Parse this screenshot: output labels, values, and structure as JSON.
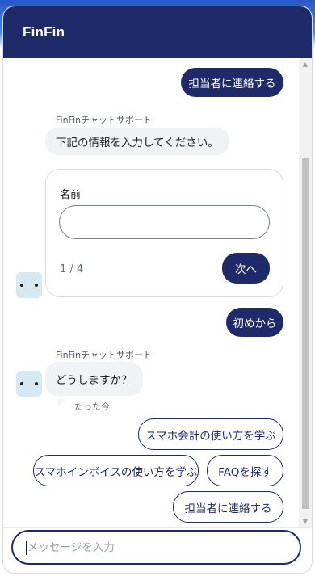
{
  "app": {
    "title": "FinFin"
  },
  "messages": {
    "user_contact_top": "担当者に連絡する",
    "bot_sender_1": "FinFinチャットサポート",
    "bot_text_1": "下記の情報を入力してください。",
    "form": {
      "field_label": "名前",
      "field_value": "",
      "step": "1 / 4",
      "next_label": "次へ"
    },
    "user_restart": "初めから",
    "bot_sender_2": "FinFinチャットサポート",
    "bot_text_2": "どうしますか？",
    "timestamp": "たった今"
  },
  "quick_replies": [
    "スマホ会計の使い方を学ぶ",
    "スマホインボイスの使い方を学ぶ",
    "FAQを探す",
    "担当者に連絡する"
  ],
  "composer": {
    "placeholder": "メッセージを入力"
  },
  "colors": {
    "brand": "#1f2a6b",
    "bubble": "#f1f2f6",
    "avatar": "#d6e9f3"
  }
}
